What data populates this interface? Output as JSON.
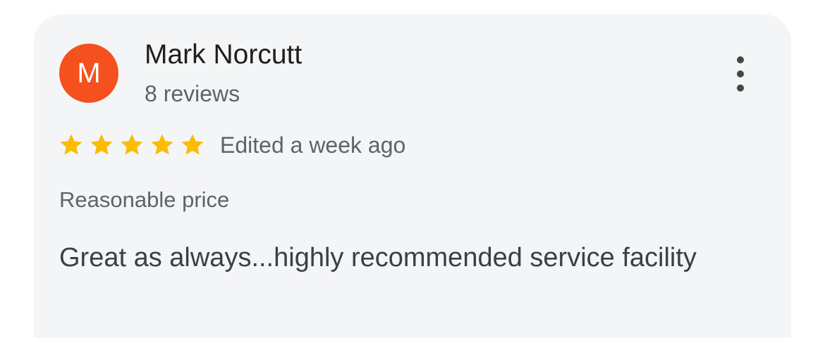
{
  "review": {
    "author": {
      "name": "Mark Norcutt",
      "initial": "M",
      "avatar_color": "#f4511e",
      "review_count": "8 reviews"
    },
    "menu_icon": "more-vert-icon",
    "rating": {
      "stars": 5,
      "max": 5,
      "star_color": "#fbbc04",
      "star_icon": "star-filled-icon"
    },
    "time": "Edited a week ago",
    "highlight": "Reasonable price",
    "text": "Great as always...highly recommended service facility"
  }
}
